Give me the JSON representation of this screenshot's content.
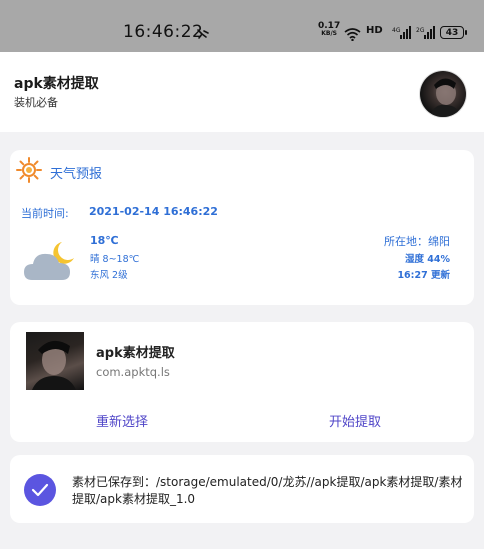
{
  "status_bar": {
    "time": "16:46:22",
    "net_speed_value": "0.17",
    "net_speed_unit": "KB/S",
    "hd_label": "HD",
    "battery": "43",
    "icons": [
      "alarm-icon",
      "wifi-icon",
      "signal-4g-icon",
      "signal-2g-icon",
      "battery-icon"
    ]
  },
  "header": {
    "title": "apk素材提取",
    "subtitle": "装机必备"
  },
  "weather": {
    "title": "天气预报",
    "time_label": "当前时间:",
    "time_value": "2021-02-14 16:46:22",
    "temperature": "18℃",
    "condition_range": "晴 8~18℃",
    "wind": "东风 2级",
    "location": "所在地：绵阳",
    "humidity": "湿度 44%",
    "updated": "16:27 更新",
    "icon": "partly-cloudy-icon"
  },
  "app_card": {
    "name": "apk素材提取",
    "package": "com.apktq.ls",
    "reselect_label": "重新选择",
    "start_label": "开始提取"
  },
  "saved": {
    "message": "素材已保存到：/storage/emulated/0/龙苏//apk提取/apk素材提取/素材提取/apk素材提取_1.0"
  },
  "colors": {
    "accent_blue": "#2f6fd6",
    "button_purple": "#5046c8",
    "check_purple": "#5b55e0",
    "status_bar_gray": "#a8a8a8",
    "page_bg": "#f2f2f4"
  }
}
